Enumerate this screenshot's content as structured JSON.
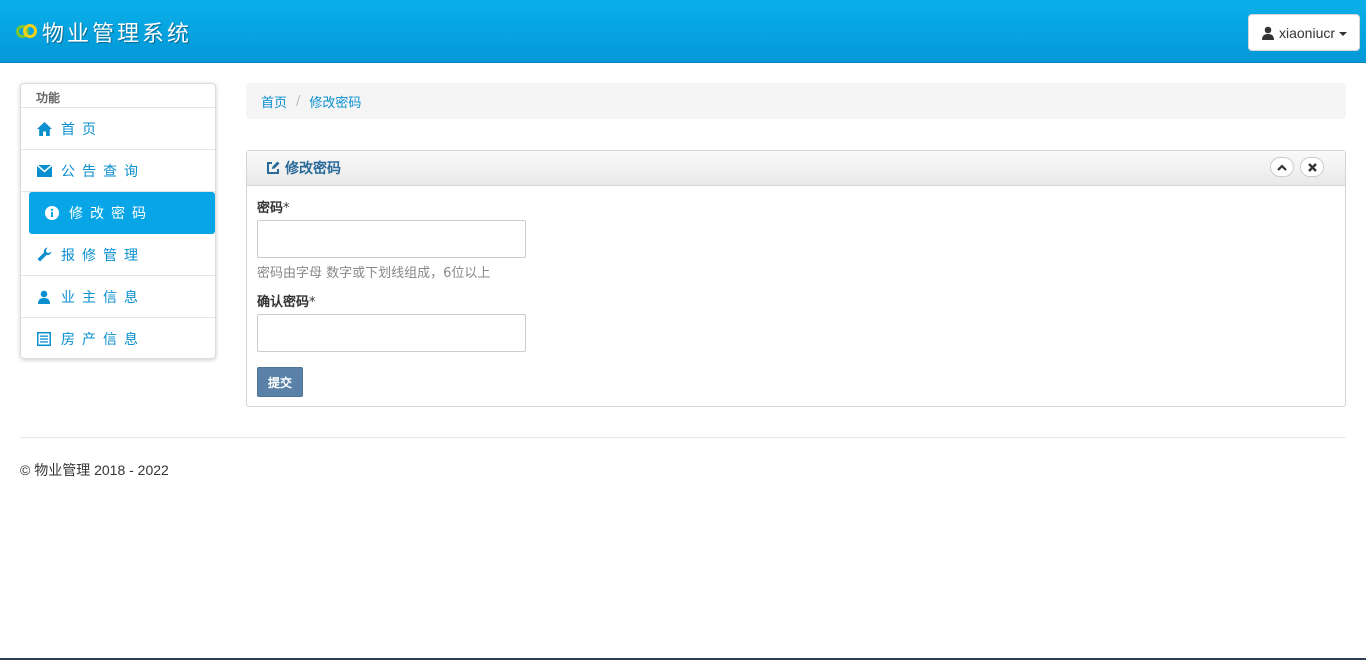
{
  "header": {
    "app_title": "物业管理系统",
    "user_name": "xiaoniucr"
  },
  "sidebar": {
    "section_title": "功能",
    "items": [
      {
        "label": "首页",
        "icon": "home-icon"
      },
      {
        "label": "公告查询",
        "icon": "envelope-icon"
      },
      {
        "label": "修改密码",
        "icon": "info-circle-icon",
        "active": true
      },
      {
        "label": "报修管理",
        "icon": "wrench-icon"
      },
      {
        "label": "业主信息",
        "icon": "user-icon"
      },
      {
        "label": "房产信息",
        "icon": "list-icon"
      }
    ]
  },
  "breadcrumb": {
    "home": "首页",
    "separator": "/",
    "current": "修改密码"
  },
  "panel": {
    "title": "修改密码",
    "password_label": "密码",
    "required_mark": "*",
    "password_value": "",
    "password_help": "密码由字母 数字或下划线组成，6位以上",
    "confirm_label": "确认密码",
    "confirm_value": "",
    "submit_label": "提交"
  },
  "footer": {
    "copyright": "© 物业管理 2018 - 2022"
  },
  "colors": {
    "header_blue": "#04a3e3",
    "accent": "#08a6e6",
    "link": "#0a8fcf",
    "submit": "#5a82a8"
  }
}
